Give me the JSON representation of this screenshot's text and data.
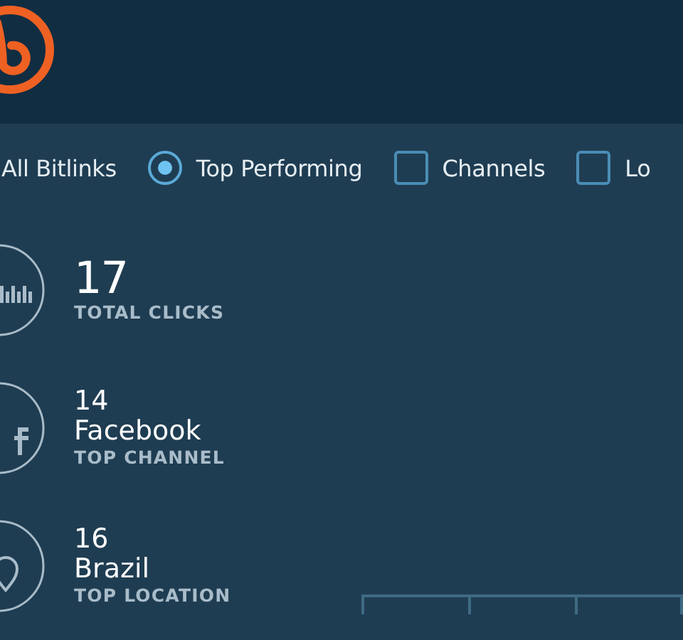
{
  "filters": [
    {
      "kind": "text",
      "label": "All Bitlinks"
    },
    {
      "kind": "radio",
      "label": "Top Performing",
      "selected": true
    },
    {
      "kind": "checkbox",
      "label": "Channels",
      "checked": false
    },
    {
      "kind": "checkbox",
      "label": "Lo",
      "checked": false
    }
  ],
  "stats": [
    {
      "kind": "clicks",
      "value": "17",
      "label": "TOTAL CLICKS"
    },
    {
      "kind": "channel",
      "value": "14",
      "name": "Facebook",
      "label": "TOP CHANNEL"
    },
    {
      "kind": "location",
      "value": "16",
      "name": "Brazil",
      "label": "TOP LOCATION"
    }
  ]
}
